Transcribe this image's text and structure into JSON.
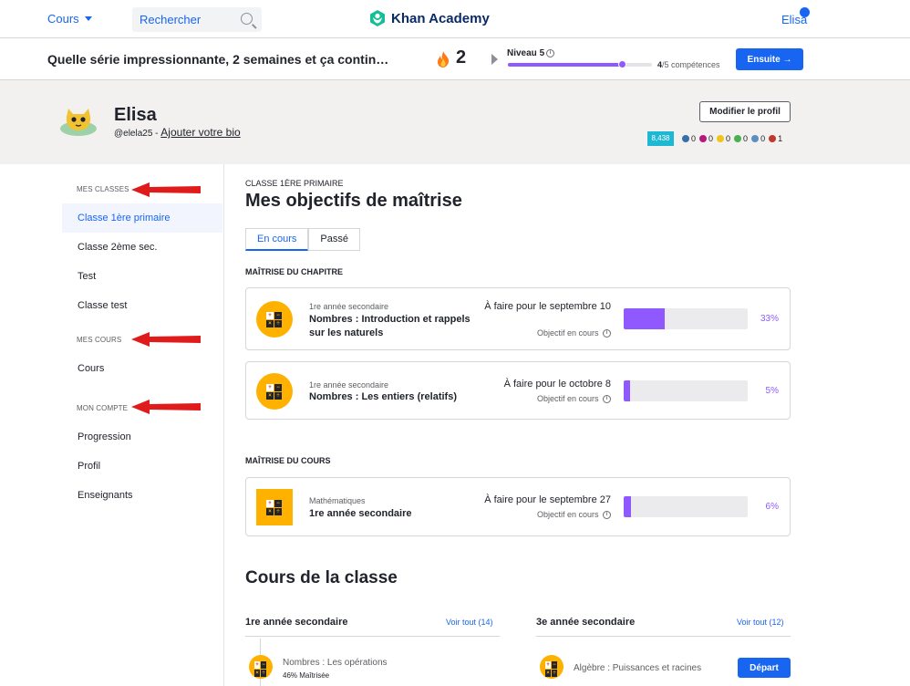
{
  "nav": {
    "courses_label": "Cours",
    "search_placeholder": "Rechercher",
    "logo_text": "Khan Academy",
    "user_name": "Elisa"
  },
  "streak": {
    "message": "Quelle série impressionnante, 2 semaines et ça contin…",
    "count": "2",
    "level_label": "Niveau 5",
    "level_progress": 0.8,
    "skills_done": "4",
    "skills_total": "/5 compétences",
    "next_label": "Ensuite →"
  },
  "profile": {
    "name": "Elisa",
    "handle": "@elela25 - ",
    "bio_link": "Ajouter votre bio",
    "edit_label": "Modifier le profil",
    "points": "8,438",
    "badges": [
      {
        "count": "0",
        "color": "#3a6ea5"
      },
      {
        "count": "0",
        "color": "#b5197a"
      },
      {
        "count": "0",
        "color": "#f0c419"
      },
      {
        "count": "0",
        "color": "#4caf50"
      },
      {
        "count": "0",
        "color": "#5a8fbf"
      },
      {
        "count": "1",
        "color": "#c0392b"
      }
    ]
  },
  "sidebar": {
    "section_classes": "MES CLASSES",
    "classes": [
      "Classe 1ère primaire",
      "Classe 2ème sec.",
      "Test",
      "Classe test"
    ],
    "section_courses": "MES COURS",
    "courses": [
      "Cours"
    ],
    "section_account": "MON COMPTE",
    "account": [
      "Progression",
      "Profil",
      "Enseignants"
    ]
  },
  "main": {
    "class_label": "CLASSE 1ÈRE PRIMAIRE",
    "title": "Mes objectifs de maîtrise",
    "tabs": [
      "En cours",
      "Passé"
    ],
    "chapter_heading": "MAÎTRISE DU CHAPITRE",
    "course_heading": "MAÎTRISE DU COURS",
    "goals": [
      {
        "sub": "1re année secondaire",
        "name": "Nombres : Introduction et rappels sur les naturels",
        "due": "À faire pour le septembre 10",
        "status": "Objectif en cours",
        "progress": 0.33,
        "pct": "33%"
      },
      {
        "sub": "1re année secondaire",
        "name": "Nombres : Les entiers (relatifs)",
        "due": "À faire pour le octobre 8",
        "status": "Objectif en cours",
        "progress": 0.05,
        "pct": "5%"
      },
      {
        "sub": "Mathématiques",
        "name": "1re année secondaire",
        "due": "À faire pour le septembre 27",
        "status": "Objectif en cours",
        "progress": 0.06,
        "pct": "6%"
      }
    ],
    "courses_title": "Cours de la classe",
    "columns": [
      {
        "title": "1re année secondaire",
        "link": "Voir tout (14)",
        "item": "Nombres : Les opérations",
        "mastery": "46% Maîtrisée"
      },
      {
        "title": "3e année secondaire",
        "link": "Voir tout (12)",
        "item": "Algèbre : Puissances et racines",
        "button": "Départ"
      }
    ]
  },
  "colors": {
    "accent": "#1865f2",
    "progress": "#9059ff",
    "icon_bg": "#ffb100",
    "arrow": "#e01b1b"
  }
}
